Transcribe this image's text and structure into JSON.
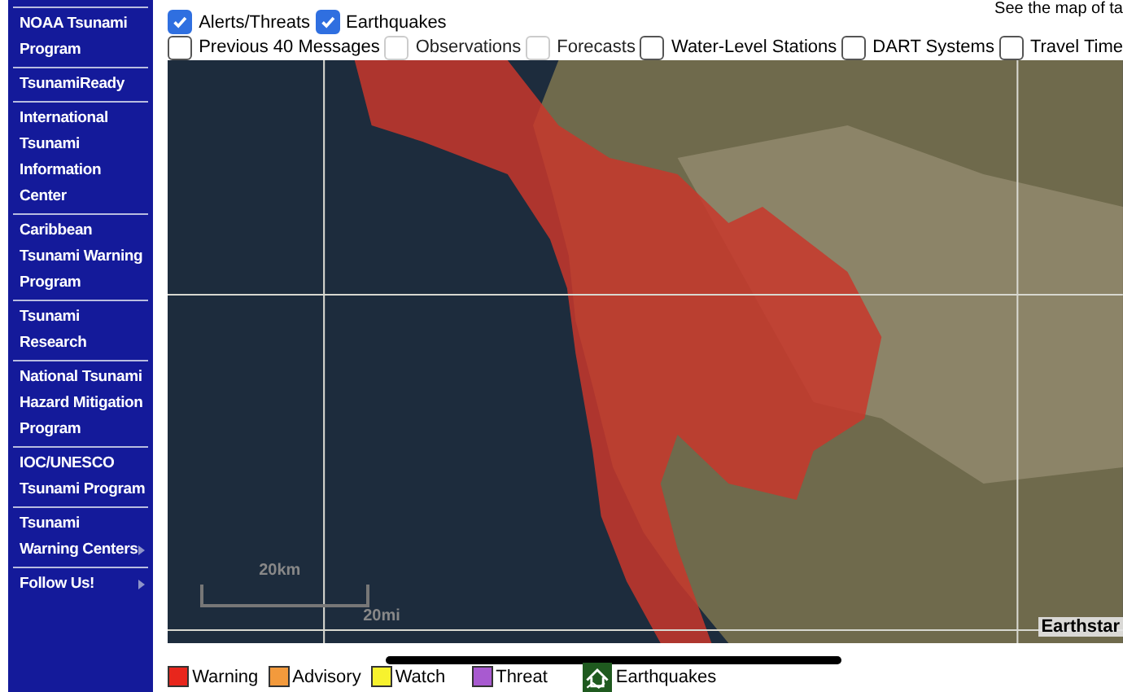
{
  "sidebar": {
    "items": [
      {
        "label": "NOAA Tsunami Program",
        "has_submenu": false
      },
      {
        "label": "TsunamiReady",
        "has_submenu": false
      },
      {
        "label": "International Tsunami Information Center",
        "has_submenu": false
      },
      {
        "label": "Caribbean Tsunami Warning Program",
        "has_submenu": false
      },
      {
        "label": "Tsunami Research",
        "has_submenu": false
      },
      {
        "label": "National Tsunami Hazard Mitigation Program",
        "has_submenu": false
      },
      {
        "label": "IOC/UNESCO Tsunami Program",
        "has_submenu": false
      },
      {
        "label": "Tsunami Warning Centers",
        "has_submenu": true
      },
      {
        "label": "Follow Us!",
        "has_submenu": true
      }
    ]
  },
  "top_note": "See the map of ta",
  "layers": [
    [
      {
        "label": "Alerts/Threats",
        "checked": true,
        "disabled": false
      },
      {
        "label": "Earthquakes",
        "checked": true,
        "disabled": false
      }
    ],
    [
      {
        "label": "Previous 40 Messages",
        "checked": false,
        "disabled": false
      },
      {
        "label": "Observations",
        "checked": false,
        "disabled": true
      },
      {
        "label": "Forecasts",
        "checked": false,
        "disabled": true
      },
      {
        "label": "Water-Level Stations",
        "checked": false,
        "disabled": false
      },
      {
        "label": "DART Systems",
        "checked": false,
        "disabled": false
      },
      {
        "label": "Travel Time",
        "checked": false,
        "disabled": false
      }
    ]
  ],
  "map": {
    "scale_km": "20km",
    "scale_mi": "20mi",
    "attribution": "Earthstar"
  },
  "legend": [
    {
      "kind": "swatch",
      "label": "Warning",
      "color": "#e8261c"
    },
    {
      "kind": "swatch",
      "label": "Advisory",
      "color": "#f39a3c"
    },
    {
      "kind": "swatch",
      "label": "Watch",
      "color": "#f7f22e"
    },
    {
      "kind": "swatch",
      "label": "Threat",
      "color": "#a85ad0"
    },
    {
      "kind": "quake",
      "label": "Earthquakes"
    }
  ]
}
